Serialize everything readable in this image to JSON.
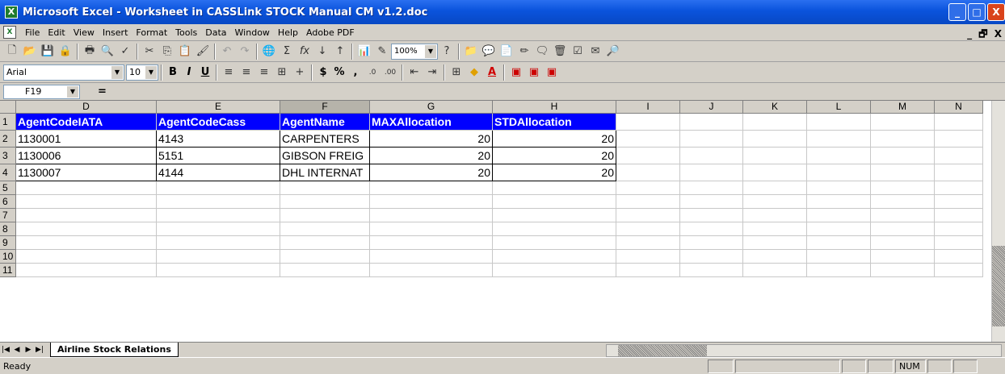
{
  "window": {
    "title": "Microsoft Excel - Worksheet in CASSLink STOCK Manual CM v1.2.doc",
    "minimize": "_",
    "maximize": "□",
    "close": "X"
  },
  "menu": {
    "items": [
      "File",
      "Edit",
      "View",
      "Insert",
      "Format",
      "Tools",
      "Data",
      "Window",
      "Help",
      "Adobe PDF"
    ],
    "doc_controls": "_ 🗗 X"
  },
  "toolbar": {
    "zoom": "100%",
    "font_name": "Arial",
    "font_size": "10"
  },
  "formula_bar": {
    "name_box": "F19",
    "equals": "="
  },
  "columns": [
    "D",
    "E",
    "F",
    "G",
    "H",
    "I",
    "J",
    "K",
    "L",
    "M",
    "N"
  ],
  "rows": [
    "1",
    "2",
    "3",
    "4",
    "5",
    "6",
    "7",
    "8",
    "9",
    "10",
    "11"
  ],
  "table": {
    "headers": [
      "AgentCodeIATA",
      "AgentCodeCass",
      "AgentName",
      "MAXAllocation",
      "STDAllocation"
    ],
    "data": [
      [
        "1130001",
        "4143",
        "CARPENTERS",
        "20",
        "20"
      ],
      [
        "1130006",
        "5151",
        "GIBSON FREIG",
        "20",
        "20"
      ],
      [
        "1130007",
        "4144",
        "DHL INTERNAT",
        "20",
        "20"
      ]
    ]
  },
  "sheet_tabs": [
    "Airline Stock Relations"
  ],
  "status": {
    "text": "Ready",
    "num": "NUM"
  },
  "colors": {
    "header_fill": "#0000ff",
    "title_bar": "#0a53dc"
  }
}
